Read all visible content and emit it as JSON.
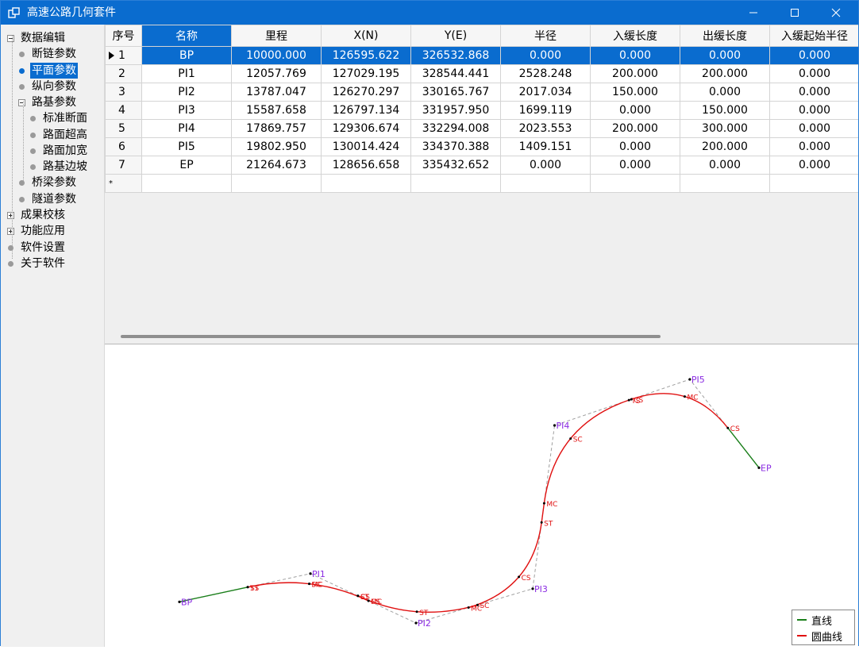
{
  "window": {
    "title": "高速公路几何套件",
    "minimize_glyph": "—",
    "maximize_glyph": "☐",
    "close_glyph": "✕"
  },
  "tree": [
    {
      "label": "数据编辑",
      "level": 0,
      "expander": "minus"
    },
    {
      "label": "断链参数",
      "level": 1
    },
    {
      "label": "平面参数",
      "level": 1,
      "selected": true
    },
    {
      "label": "纵向参数",
      "level": 1
    },
    {
      "label": "路基参数",
      "level": 1,
      "expander": "minus"
    },
    {
      "label": "标准断面",
      "level": 2
    },
    {
      "label": "路面超高",
      "level": 2
    },
    {
      "label": "路面加宽",
      "level": 2
    },
    {
      "label": "路基边坡",
      "level": 2
    },
    {
      "label": "桥梁参数",
      "level": 1
    },
    {
      "label": "隧道参数",
      "level": 1
    },
    {
      "label": "成果校核",
      "level": 0,
      "expander": "plus"
    },
    {
      "label": "功能应用",
      "level": 0,
      "expander": "plus"
    },
    {
      "label": "软件设置",
      "level": 0
    },
    {
      "label": "关于软件",
      "level": 0
    }
  ],
  "grid": {
    "columns": [
      "序号",
      "名称",
      "里程",
      "X(N)",
      "Y(E)",
      "半径",
      "入缓长度",
      "出缓长度",
      "入缓起始半径"
    ],
    "rows": [
      [
        "1",
        "BP",
        "10000.000",
        "126595.622",
        "326532.868",
        "0.000",
        "0.000",
        "0.000",
        "0.000"
      ],
      [
        "2",
        "PI1",
        "12057.769",
        "127029.195",
        "328544.441",
        "2528.248",
        "200.000",
        "200.000",
        "0.000"
      ],
      [
        "3",
        "PI2",
        "13787.047",
        "126270.297",
        "330165.767",
        "2017.034",
        "150.000",
        "0.000",
        "0.000"
      ],
      [
        "4",
        "PI3",
        "15587.658",
        "126797.134",
        "331957.950",
        "1699.119",
        "0.000",
        "150.000",
        "0.000"
      ],
      [
        "5",
        "PI4",
        "17869.757",
        "129306.674",
        "332294.008",
        "2023.553",
        "200.000",
        "300.000",
        "0.000"
      ],
      [
        "6",
        "PI5",
        "19802.950",
        "130014.424",
        "334370.388",
        "1409.151",
        "0.000",
        "200.000",
        "0.000"
      ],
      [
        "7",
        "EP",
        "21264.673",
        "128656.658",
        "335432.652",
        "0.000",
        "0.000",
        "0.000",
        "0.000"
      ]
    ],
    "new_row_marker": "*",
    "selected_row": 0
  },
  "plot": {
    "legend": [
      {
        "label": "直线",
        "color": "#1a7f1a"
      },
      {
        "label": "圆曲线",
        "color": "#e01010"
      }
    ],
    "colors": {
      "line": "#1a7f1a",
      "curve": "#e01010",
      "spiral": "#f0a020",
      "pi": "#8a2be2",
      "tangent": "#a0a0a0",
      "label": "#e01010"
    },
    "pi_labels": [
      "BP",
      "PI1",
      "PI2",
      "PI3",
      "PI4",
      "PI5",
      "EP"
    ],
    "keypoint_labels": [
      "TS",
      "SC",
      "MC",
      "CS",
      "ST",
      "SC",
      "MC",
      "CS",
      "ST",
      "MC",
      "SC",
      "TS",
      "CS",
      "MC",
      "CS",
      "ST",
      "MC",
      "CS",
      "ST"
    ]
  }
}
